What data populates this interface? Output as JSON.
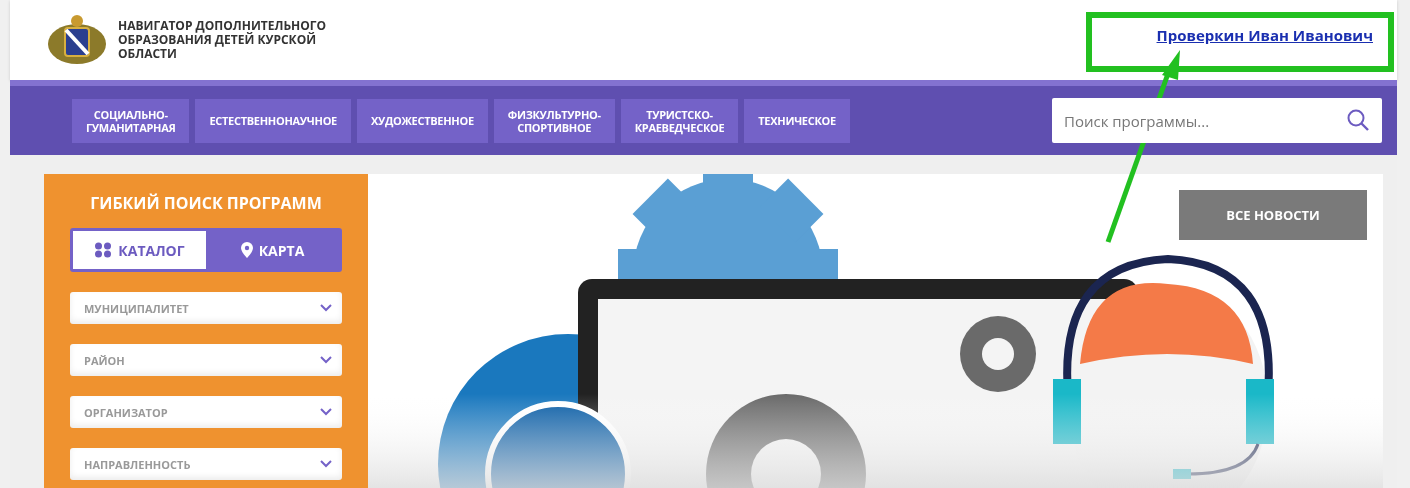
{
  "header": {
    "logo_title": "НАВИГАТОР ДОПОЛНИТЕЛЬНОГО ОБРАЗОВАНИЯ ДЕТЕЙ КУРСКОЙ ОБЛАСТИ",
    "user_link": "Проверкин Иван Иванович"
  },
  "nav": {
    "items": [
      {
        "label": "СОЦИАЛЬНО-ГУМАНИТАРНАЯ"
      },
      {
        "label": "ЕСТЕСТВЕННОНАУЧНОЕ"
      },
      {
        "label": "ХУДОЖЕСТВЕННОЕ"
      },
      {
        "label": "ФИЗКУЛЬТУРНО-СПОРТИВНОЕ"
      },
      {
        "label": "ТУРИСТСКО-КРАЕВЕДЧЕСКОЕ"
      },
      {
        "label": "ТЕХНИЧЕСКОЕ"
      }
    ],
    "search": {
      "placeholder": "Поиск программы..."
    }
  },
  "sidebar": {
    "title": "ГИБКИЙ ПОИСК ПРОГРАММ",
    "tabs": [
      {
        "label": "КАТАЛОГ",
        "kind": "grid",
        "selected": true
      },
      {
        "label": "КАРТА",
        "kind": "pin",
        "selected": false
      }
    ],
    "filters": [
      {
        "label": "МУНИЦИПАЛИТЕТ"
      },
      {
        "label": "РАЙОН"
      },
      {
        "label": "ОРГАНИЗАТОР"
      },
      {
        "label": "НАПРАВЛЕННОСТЬ"
      }
    ]
  },
  "banner": {
    "button": "ВСЕ НОВОСТИ"
  }
}
